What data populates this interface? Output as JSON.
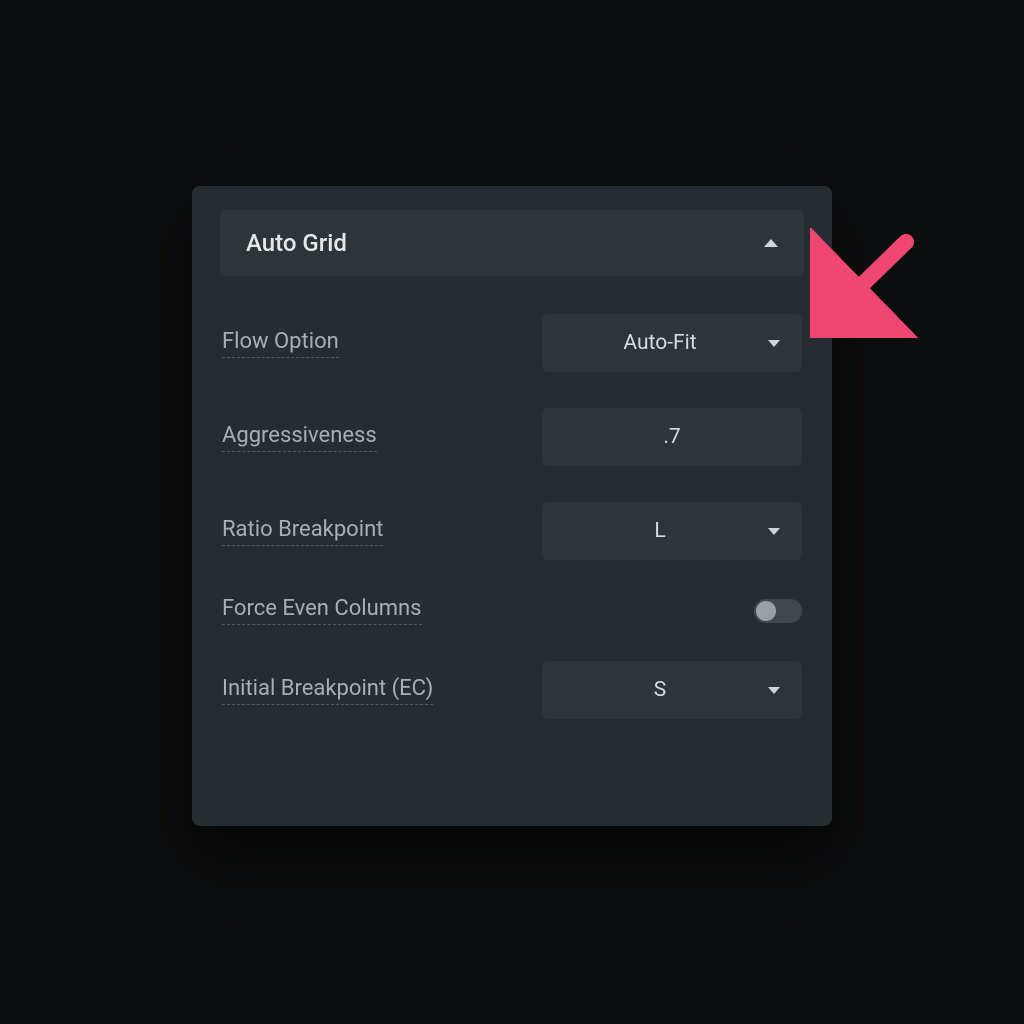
{
  "panel": {
    "title": "Auto Grid",
    "rows": [
      {
        "label": "Flow Option",
        "type": "select",
        "value": "Auto-Fit"
      },
      {
        "label": "Aggressiveness",
        "type": "input",
        "value": ".7"
      },
      {
        "label": "Ratio Breakpoint",
        "type": "select",
        "value": "L"
      },
      {
        "label": "Force Even Columns",
        "type": "toggle",
        "value": "off"
      },
      {
        "label": "Initial Breakpoint (EC)",
        "type": "select",
        "value": "S"
      }
    ]
  },
  "annotation": {
    "arrow_color": "#ef476f",
    "target": "flow-option-select"
  }
}
